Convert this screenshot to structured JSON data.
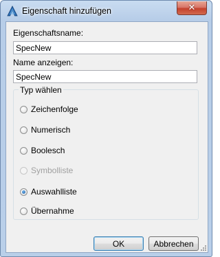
{
  "window": {
    "title": "Eigenschaft hinzufügen",
    "close_glyph": "✕"
  },
  "form": {
    "property_name_label": "Eigenschaftsname:",
    "property_name_value": "SpecNew",
    "display_name_label": "Name anzeigen:",
    "display_name_value": "SpecNew"
  },
  "type_group": {
    "legend": "Typ wählen",
    "options": [
      {
        "label": "Zeichenfolge",
        "checked": false,
        "enabled": true
      },
      {
        "label": "Numerisch",
        "checked": false,
        "enabled": true
      },
      {
        "label": "Boolesch",
        "checked": false,
        "enabled": true
      },
      {
        "label": "Symbolliste",
        "checked": false,
        "enabled": false
      },
      {
        "label": "Auswahlliste",
        "checked": true,
        "enabled": true
      },
      {
        "label": "Übernahme",
        "checked": false,
        "enabled": true
      }
    ]
  },
  "buttons": {
    "ok": "OK",
    "cancel": "Abbrechen"
  },
  "icons": {
    "app": "autocad-a-icon",
    "close": "close-icon",
    "grip": "resize-grip-icon"
  },
  "colors": {
    "close_button": "#c4412d",
    "default_button_border": "#3c7fb1",
    "radio_dot": "#1c5a9e"
  }
}
